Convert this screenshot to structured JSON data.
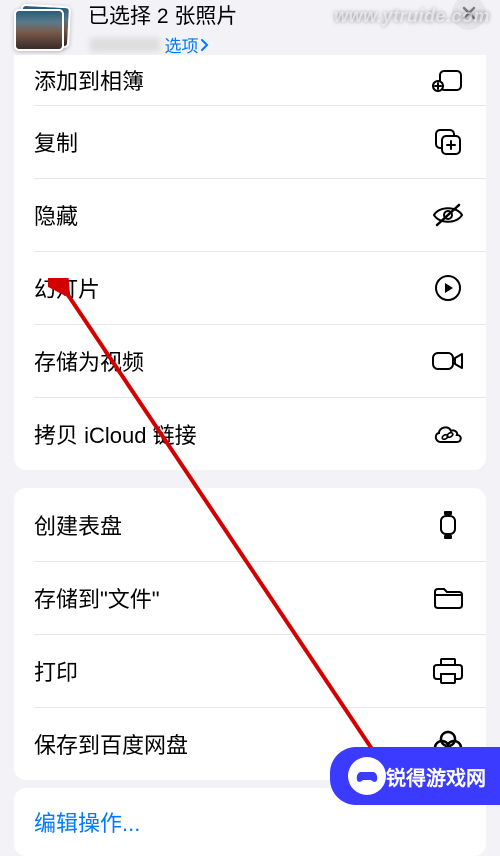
{
  "header": {
    "title": "已选择 2 张照片",
    "options_label": "选项"
  },
  "group1": [
    {
      "label": "添加到相簿",
      "icon": "add-to-album-icon"
    },
    {
      "label": "复制",
      "icon": "copy-icon"
    },
    {
      "label": "隐藏",
      "icon": "hide-icon"
    },
    {
      "label": "幻灯片",
      "icon": "play-icon"
    },
    {
      "label": "存储为视频",
      "icon": "video-icon"
    },
    {
      "label": "拷贝 iCloud 链接",
      "icon": "cloud-link-icon"
    }
  ],
  "group2": [
    {
      "label": "创建表盘",
      "icon": "watch-icon"
    },
    {
      "label": "存储到\"文件\"",
      "icon": "folder-icon"
    },
    {
      "label": "打印",
      "icon": "print-icon"
    },
    {
      "label": "保存到百度网盘",
      "icon": "baidu-cloud-icon"
    }
  ],
  "footer": {
    "edit_label": "编辑操作..."
  },
  "watermark": {
    "top": "www.ytruide.com",
    "badge": "锐得游戏网"
  }
}
